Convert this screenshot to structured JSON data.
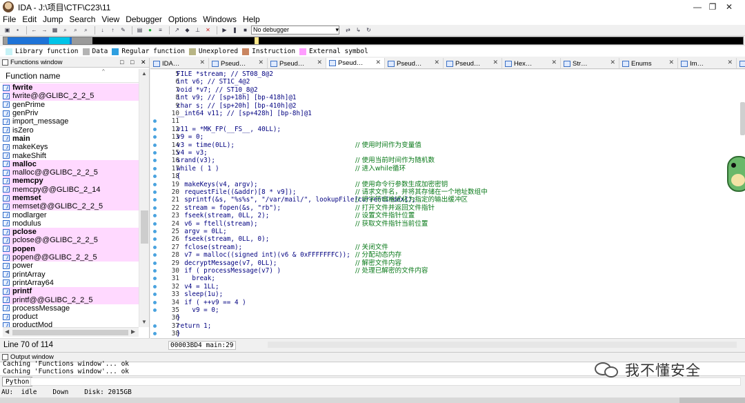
{
  "window": {
    "title": "IDA - J:\\项目\\CTF\\C23\\11",
    "controls": [
      "—",
      "❐",
      "✕"
    ]
  },
  "menu": [
    "File",
    "Edit",
    "Jump",
    "Search",
    "View",
    "Debugger",
    "Options",
    "Windows",
    "Help"
  ],
  "toolbar": {
    "debugger_select": "No debugger",
    "icons": [
      "open-icon",
      "save-icon",
      "back-icon",
      "forward-icon",
      "hex-icon",
      "search-binary-icon",
      "search-text-icon",
      "search-next-icon",
      "import-icon",
      "export-icon",
      "patch-icon",
      "graph-icon",
      "green-run-icon",
      "script-icon",
      "pointer-icon",
      "breakpoint-icon",
      "pin-icon",
      "cross-icon",
      "play-icon",
      "pause-icon",
      "stop-icon",
      "attach-icon",
      "step-icon",
      "refresh-icon"
    ]
  },
  "nav_band": {
    "segments": [
      {
        "color": "#9a9a9a",
        "from": 0.0,
        "to": 0.006
      },
      {
        "color": "#1e73d7",
        "from": 0.006,
        "to": 0.062
      },
      {
        "color": "#00c4e8",
        "from": 0.062,
        "to": 0.09
      },
      {
        "color": "#1e73d7",
        "from": 0.09,
        "to": 0.092
      },
      {
        "color": "#9a9a9a",
        "from": 0.092,
        "to": 0.12
      },
      {
        "color": "#000000",
        "from": 0.12,
        "to": 0.34
      },
      {
        "color": "#ffe88a",
        "from": 0.34,
        "to": 0.345
      },
      {
        "color": "#000000",
        "from": 0.345,
        "to": 1.0
      }
    ]
  },
  "legend": [
    {
      "label": "Library function",
      "color": "#c6f2f6"
    },
    {
      "label": "Data",
      "color": "#b4b4b4"
    },
    {
      "label": "Regular function",
      "color": "#2e9fe0"
    },
    {
      "label": "Unexplored",
      "color": "#b8b585"
    },
    {
      "label": "Instruction",
      "color": "#c98560"
    },
    {
      "label": "External symbol",
      "color": "#ff9dff"
    }
  ],
  "functions_window": {
    "title": "Functions window",
    "controls": [
      "□",
      "□",
      "✕"
    ],
    "column": "Function name",
    "status": "Line 70 of 114",
    "items": [
      {
        "name": "fwrite",
        "style": "pinkbold"
      },
      {
        "name": "fwrite@@GLIBC_2_2_5",
        "style": "pink"
      },
      {
        "name": "genPrime",
        "style": ""
      },
      {
        "name": "genPriv",
        "style": ""
      },
      {
        "name": "import_message",
        "style": ""
      },
      {
        "name": "isZero",
        "style": ""
      },
      {
        "name": "main",
        "style": "bold"
      },
      {
        "name": "makeKeys",
        "style": ""
      },
      {
        "name": "makeShift",
        "style": ""
      },
      {
        "name": "malloc",
        "style": "pinkbold"
      },
      {
        "name": "malloc@@GLIBC_2_2_5",
        "style": "pink"
      },
      {
        "name": "memcpy",
        "style": "pinkbold"
      },
      {
        "name": "memcpy@@GLIBC_2_14",
        "style": "pink"
      },
      {
        "name": "memset",
        "style": "pinkbold"
      },
      {
        "name": "memset@@GLIBC_2_2_5",
        "style": "pink"
      },
      {
        "name": "modlarger",
        "style": ""
      },
      {
        "name": "modulus",
        "style": ""
      },
      {
        "name": "pclose",
        "style": "pinkbold"
      },
      {
        "name": "pclose@@GLIBC_2_2_5",
        "style": "pink"
      },
      {
        "name": "popen",
        "style": "pinkbold"
      },
      {
        "name": "popen@@GLIBC_2_2_5",
        "style": "pink"
      },
      {
        "name": "power",
        "style": ""
      },
      {
        "name": "printArray",
        "style": ""
      },
      {
        "name": "printArray64",
        "style": ""
      },
      {
        "name": "printf",
        "style": "pinkbold"
      },
      {
        "name": "printf@@GLIBC_2_2_5",
        "style": "pink"
      },
      {
        "name": "processMessage",
        "style": ""
      },
      {
        "name": "product",
        "style": ""
      },
      {
        "name": "productMod",
        "style": ""
      }
    ]
  },
  "tabs": [
    {
      "label": "IDA…",
      "close": "✕",
      "active": false
    },
    {
      "label": "Pseud…",
      "close": "✕",
      "active": false
    },
    {
      "label": "Pseud…",
      "close": "✕",
      "active": false
    },
    {
      "label": "Pseud…",
      "close": "✕",
      "active": true
    },
    {
      "label": "Pseud…",
      "close": "✕",
      "active": false
    },
    {
      "label": "Pseud…",
      "close": "✕",
      "active": false
    },
    {
      "label": "Hex…",
      "close": "✕",
      "active": false
    },
    {
      "label": "Str…",
      "close": "✕",
      "active": false
    },
    {
      "label": "Enums",
      "close": "✕",
      "active": false
    },
    {
      "label": "Im…",
      "close": "✕",
      "active": false
    },
    {
      "label": "Ex…",
      "close": "✕",
      "active": false
    }
  ],
  "code": [
    {
      "n": "5",
      "dot": false,
      "code": "FILE *stream; // ST08_8@2",
      "cmt": ""
    },
    {
      "n": "6",
      "dot": false,
      "code": "int v6; // ST1C_4@2",
      "cmt": ""
    },
    {
      "n": "7",
      "dot": false,
      "code": "void *v7; // ST10_8@2",
      "cmt": ""
    },
    {
      "n": "8",
      "dot": false,
      "code": "int v9; // [sp+18h] [bp-418h]@1",
      "cmt": ""
    },
    {
      "n": "9",
      "dot": false,
      "code": "char s; // [sp+20h] [bp-410h]@2",
      "cmt": ""
    },
    {
      "n": "10",
      "dot": false,
      "code": "__int64 v11; // [sp+428h] [bp-8h]@1",
      "cmt": ""
    },
    {
      "n": "11",
      "dot": true,
      "code": "",
      "cmt": ""
    },
    {
      "n": "12",
      "dot": true,
      "code": "v11 = *MK_FP(__FS__, 40LL);",
      "cmt": ""
    },
    {
      "n": "13",
      "dot": true,
      "code": "v9 = 0;",
      "cmt": ""
    },
    {
      "n": "14",
      "dot": true,
      "code": "v3 = time(0LL);",
      "cmt": "// 使用时间作为变量值"
    },
    {
      "n": "15",
      "dot": true,
      "code": "v4 = v3;",
      "cmt": ""
    },
    {
      "n": "16",
      "dot": true,
      "code": "srand(v3);",
      "cmt": "// 使用当前时间作为随机数"
    },
    {
      "n": "17",
      "dot": true,
      "code": "while ( 1 )",
      "cmt": "// 进入while循环"
    },
    {
      "n": "18",
      "dot": true,
      "code": "{",
      "cmt": ""
    },
    {
      "n": "19",
      "dot": true,
      "code": "  makeKeys(v4, argv);",
      "cmt": "// 使用命令行参数生成加密密钥"
    },
    {
      "n": "20",
      "dot": true,
      "code": "  requestFile((&addr)[8 * v9]);",
      "cmt": "// 请求文件名，并将其存储在一个地址数组中"
    },
    {
      "n": "21",
      "dot": true,
      "code": "  sprintf(&s, \"%s%s\", \"/var/mail/\", lookupFile[currentIndex]);",
      "cmt": "// 将字符串格式化为指定的输出缓冲区"
    },
    {
      "n": "22",
      "dot": true,
      "code": "  stream = fopen(&s, \"rb\");",
      "cmt": "// 打开文件并返回文件指针"
    },
    {
      "n": "23",
      "dot": true,
      "code": "  fseek(stream, 0LL, 2);",
      "cmt": "// 设置文件指针位置"
    },
    {
      "n": "24",
      "dot": true,
      "code": "  v6 = ftell(stream);",
      "cmt": "// 获取文件指针当前位置"
    },
    {
      "n": "25",
      "dot": true,
      "code": "  argv = 0LL;",
      "cmt": ""
    },
    {
      "n": "26",
      "dot": true,
      "code": "  fseek(stream, 0LL, 0);",
      "cmt": ""
    },
    {
      "n": "27",
      "dot": true,
      "code": "  fclose(stream);",
      "cmt": "// 关闭文件"
    },
    {
      "n": "28",
      "dot": true,
      "code": "  v7 = malloc((signed int)(v6 & 0xFFFFFFFC));",
      "cmt": "// 分配动态内存"
    },
    {
      "n": "29",
      "dot": true,
      "code": "  decryptMessage(v7, 0LL);",
      "cmt": "// 解密文件内容"
    },
    {
      "n": "30",
      "dot": true,
      "code": "  if ( processMessage(v7) )",
      "cmt": "// 处理已解密的文件内容"
    },
    {
      "n": "31",
      "dot": true,
      "code": "    break;",
      "cmt": ""
    },
    {
      "n": "32",
      "dot": true,
      "code": "  v4 = 1LL;",
      "cmt": ""
    },
    {
      "n": "33",
      "dot": true,
      "code": "  sleep(1u);",
      "cmt": ""
    },
    {
      "n": "34",
      "dot": true,
      "code": "  if ( ++v9 == 4 )",
      "cmt": ""
    },
    {
      "n": "35",
      "dot": true,
      "code": "    v9 = 0;",
      "cmt": ""
    },
    {
      "n": "36",
      "dot": false,
      "code": "}",
      "cmt": ""
    },
    {
      "n": "37",
      "dot": true,
      "code": "return 1;",
      "cmt": ""
    },
    {
      "n": "38",
      "dot": true,
      "code": "}",
      "cmt": ""
    }
  ],
  "code_status": "00003BD4 main:29",
  "output_window": {
    "title": "Output window",
    "controls": [
      "□",
      "□",
      "✕"
    ],
    "lines": [
      "Caching 'Functions window'... ok",
      "Caching 'Functions window'... ok"
    ]
  },
  "python_button": "Python",
  "statusbar": {
    "au": "AU:",
    "state": "idle",
    "direction": "Down",
    "disk": "Disk: 2015GB"
  },
  "watermark": "我不懂安全"
}
